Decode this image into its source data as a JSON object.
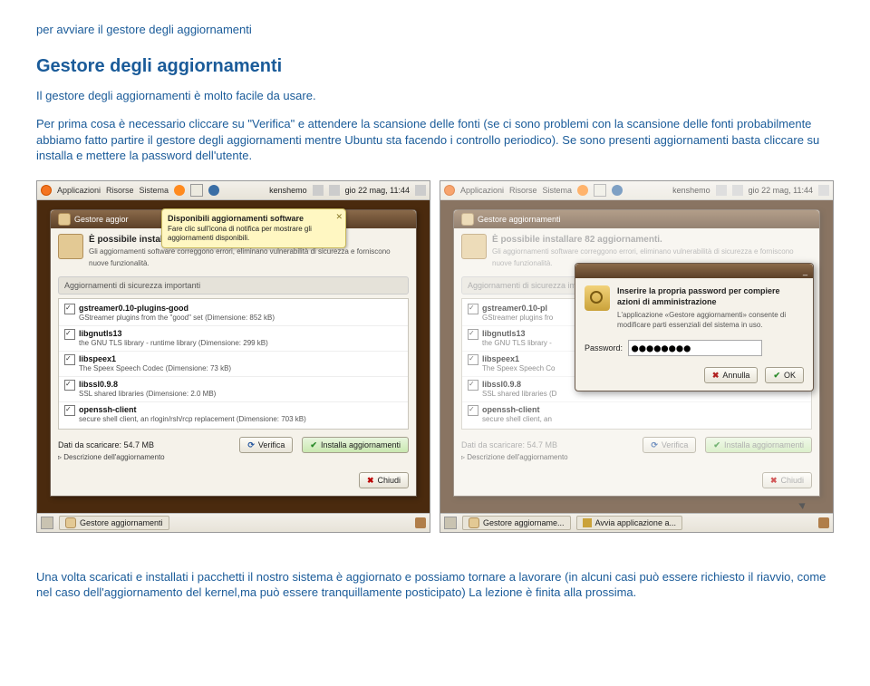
{
  "intro_line": "per avviare il gestore degli aggiornamenti",
  "heading": "Gestore degli aggiornamenti",
  "para1": "Il gestore degli aggiornamenti è molto facile da usare.",
  "para2": "Per prima cosa è necessario cliccare su \"Verifica\" e attendere la scansione delle fonti (se ci sono problemi con la scansione delle fonti probabilmente abbiamo fatto partire il gestore degli aggiornamenti mentre Ubuntu sta facendo i controllo periodico). Se sono presenti aggiornamenti basta cliccare su installa e mettere la password dell'utente.",
  "para3": "Una volta scaricati e installati i pacchetti il nostro sistema è aggiornato e possiamo tornare a lavorare (in alcuni casi può essere richiesto il riavvio, come nel caso dell'aggiornamento del kernel,ma può essere tranquillamente posticipato) La lezione è finita alla prossima.",
  "panel": {
    "menu": [
      "Applicazioni",
      "Risorse",
      "Sistema"
    ],
    "user": "kenshemo",
    "clock": "gio 22 mag, 11:44"
  },
  "window": {
    "title_short": "Gestore aggior",
    "title_full": "Gestore aggiornamenti",
    "headline": "È possibile installare 82 aggiornamenti.",
    "subline": "Gli aggiornamenti software correggono errori, eliminano vulnerabilità di sicurezza e forniscono nuove funzionalità.",
    "section": "Aggiornamenti di sicurezza importanti",
    "updates": [
      {
        "name": "gstreamer0.10-plugins-good",
        "desc": "GStreamer plugins from the \"good\" set (Dimensione: 852 kB)"
      },
      {
        "name": "libgnutls13",
        "desc": "the GNU TLS library - runtime library (Dimensione: 299 kB)"
      },
      {
        "name": "libspeex1",
        "desc": "The Speex Speech Codec (Dimensione: 73 kB)"
      },
      {
        "name": "libssl0.9.8",
        "desc": "SSL shared libraries (Dimensione: 2.0 MB)"
      },
      {
        "name": "openssh-client",
        "desc": "secure shell client, an rlogin/rsh/rcp replacement (Dimensione: 703 kB)"
      }
    ],
    "download_label": "Dati da scaricare: 54.7 MB",
    "verify_btn": "Verifica",
    "install_btn": "Installa aggiornamenti",
    "desc_toggle": "Descrizione dell'aggiornamento",
    "close_btn": "Chiudi"
  },
  "tooltip": {
    "title": "Disponibili aggiornamenti software",
    "body": "Fare clic sull'icona di notifica per mostrare gli aggiornamenti disponibili."
  },
  "taskbar": {
    "task1": "Gestore aggiornamenti",
    "task1_short": "Gestore aggiorname...",
    "task2": "Avvia applicazione a..."
  },
  "auth": {
    "title": "Inserire la propria password per compiere azioni di amministrazione",
    "body": "L'applicazione «Gestore aggiornamenti» consente di modificare parti essenziali del sistema in uso.",
    "password_label": "Password:",
    "password_value": "●●●●●●●●",
    "cancel": "Annulla",
    "ok": "OK"
  },
  "right_updates": [
    {
      "name": "gstreamer0.10-pl",
      "desc": "GStreamer plugins fro"
    },
    {
      "name": "libgnutls13",
      "desc": "the GNU TLS library -"
    },
    {
      "name": "libspeex1",
      "desc": "The Speex Speech Co"
    },
    {
      "name": "libssl0.9.8",
      "desc": "SSL shared libraries (D"
    },
    {
      "name": "openssh-client",
      "desc": "secure shell client, an"
    }
  ]
}
